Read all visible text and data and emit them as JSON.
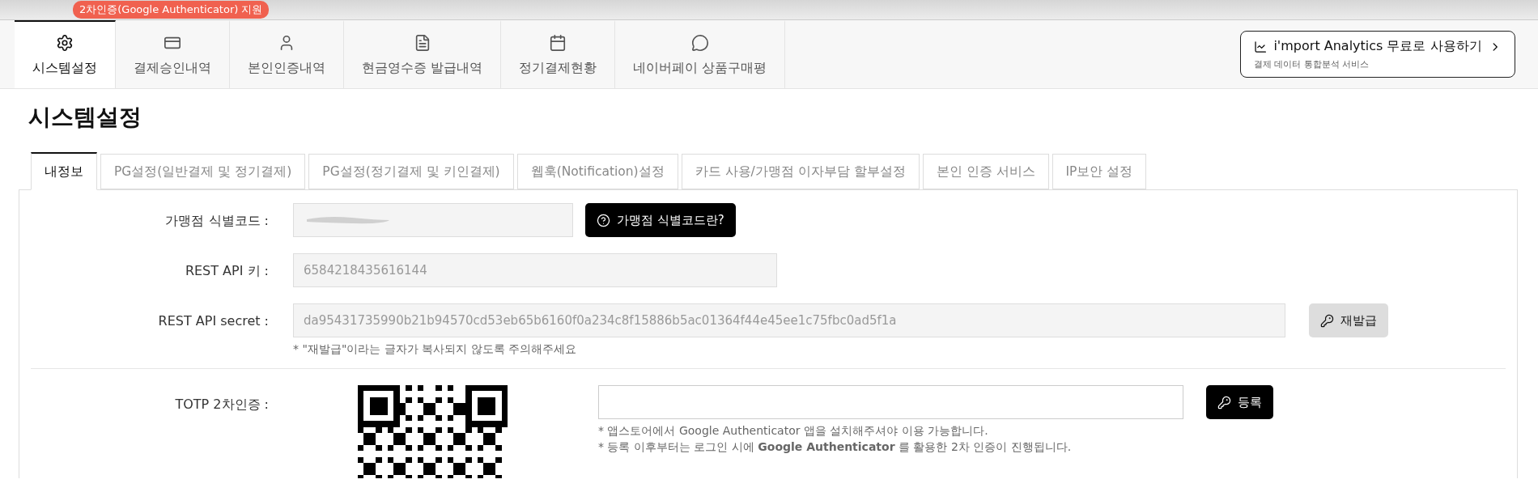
{
  "badge": "2차인증(Google Authenticator) 지원",
  "nav": [
    {
      "label": "시스템설정",
      "selected": true
    },
    {
      "label": "결제승인내역",
      "selected": false
    },
    {
      "label": "본인인증내역",
      "selected": false
    },
    {
      "label": "현금영수증 발급내역",
      "selected": false
    },
    {
      "label": "정기결제현황",
      "selected": false
    },
    {
      "label": "네이버페이 상품구매평",
      "selected": false
    }
  ],
  "promo": {
    "title": "i'mport Analytics 무료로 사용하기",
    "subtitle": "결제 데이터 통합분석 서비스"
  },
  "page_title": "시스템설정",
  "tabs": [
    {
      "label": "내정보",
      "selected": true
    },
    {
      "label": "PG설정(일반결제 및 정기결제)",
      "selected": false
    },
    {
      "label": "PG설정(정기결제 및 키인결제)",
      "selected": false
    },
    {
      "label": "웹훅(Notification)설정",
      "selected": false
    },
    {
      "label": "카드 사용/가맹점 이자부담 할부설정",
      "selected": false
    },
    {
      "label": "본인 인증 서비스",
      "selected": false
    },
    {
      "label": "IP보안 설정",
      "selected": false
    }
  ],
  "merchant_code": {
    "label": "가맹점 식별코드 :",
    "help_button": "가맹점 식별코드란?"
  },
  "api_key": {
    "label": "REST API 키 :",
    "value": "6584218435616144"
  },
  "api_secret": {
    "label": "REST API secret :",
    "value": "da95431735990b21b94570cd53eb65b6160f0a234c8f15886b5ac01364f44e45ee1c75fbc0ad5f1a",
    "button": "재발급",
    "note": "* \"재발급\"이라는 글자가 복사되지 않도록 주의해주세요"
  },
  "totp": {
    "label": "TOTP 2차인증 :",
    "button": "등록",
    "notes": [
      "* 앱스토어에서 Google Authenticator 앱을 설치해주셔야 이용 가능합니다.",
      "* 등록 이후부터는 로그인 시에 **Google Authenticator** 를 활용한 2차 인증이 진행됩니다."
    ]
  }
}
